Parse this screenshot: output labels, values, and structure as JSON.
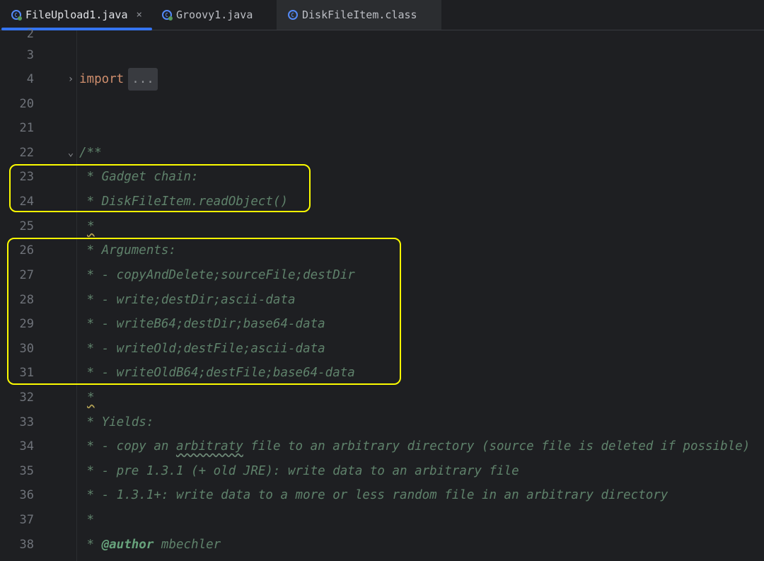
{
  "tabs": [
    {
      "label": "FileUpload1.java",
      "close": "×",
      "icon": "java-class-icon",
      "active": true
    },
    {
      "label": "Groovy1.java",
      "icon": "java-class-icon",
      "active": false
    },
    {
      "label": "DiskFileItem.class",
      "icon": "class-file-icon",
      "active": false
    }
  ],
  "lines": [
    {
      "num": "2"
    },
    {
      "num": "3",
      "text": ""
    },
    {
      "num": "4",
      "keyword": "import",
      "folded": "..."
    },
    {
      "num": "20",
      "text": ""
    },
    {
      "num": "21",
      "text": ""
    },
    {
      "num": "22",
      "text": "/**"
    },
    {
      "num": "23",
      "text": " * Gadget chain:"
    },
    {
      "num": "24",
      "text": " * DiskFileItem.readObject()"
    },
    {
      "num": "25",
      "text": "*"
    },
    {
      "num": "26",
      "text": " * Arguments:"
    },
    {
      "num": "27",
      "text": " * - copyAndDelete;sourceFile;destDir"
    },
    {
      "num": "28",
      "text": " * - write;destDir;ascii-data"
    },
    {
      "num": "29",
      "text": " * - writeB64;destDir;base64-data"
    },
    {
      "num": "30",
      "text": " * - writeOld;destFile;ascii-data"
    },
    {
      "num": "31",
      "text": " * - writeOldB64;destFile;base64-data"
    },
    {
      "num": "32",
      "text": "*"
    },
    {
      "num": "33",
      "text": " * Yields:"
    },
    {
      "num": "34",
      "pre": " * - copy an ",
      "typo": "arbitraty",
      "post": " file to an arbitrary directory (source file is deleted if possible)"
    },
    {
      "num": "35",
      "text": " * - pre 1.3.1 (+ old JRE): write data to an arbitrary file"
    },
    {
      "num": "36",
      "text": " * - 1.3.1+: write data to a more or less random file in an arbitrary directory"
    },
    {
      "num": "37",
      "text": " *"
    },
    {
      "num": "38",
      "pre": " * ",
      "tag": "@author",
      "post": " mbechler"
    }
  ],
  "fold_markers": {
    "line4": "›",
    "line22": "⌄"
  }
}
